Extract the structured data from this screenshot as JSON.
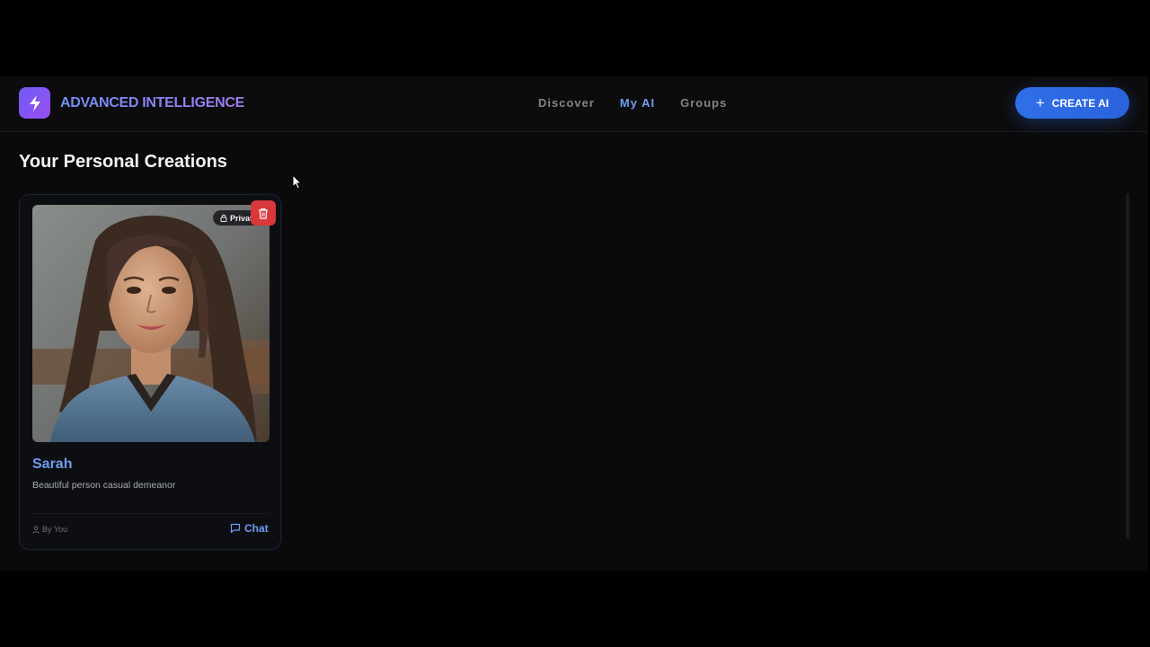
{
  "header": {
    "brand_name": "ADVANCED INTELLIGENCE",
    "logo_icon": "lightning-bolt-icon",
    "nav": [
      {
        "label": "Discover",
        "active": false
      },
      {
        "label": "My AI",
        "active": true
      },
      {
        "label": "Groups",
        "active": false
      }
    ],
    "create_label": "CREATE AI"
  },
  "main": {
    "title": "Your Personal Creations",
    "cards": [
      {
        "name": "Sarah",
        "description": "Beautiful person casual demeanor",
        "badge": "Private",
        "author": "By You",
        "chat_label": "Chat"
      }
    ]
  },
  "colors": {
    "accent": "#6f9cf3",
    "primary_button": "#2f6fe8",
    "danger": "#d9383b",
    "background": "#0a0a0b"
  }
}
